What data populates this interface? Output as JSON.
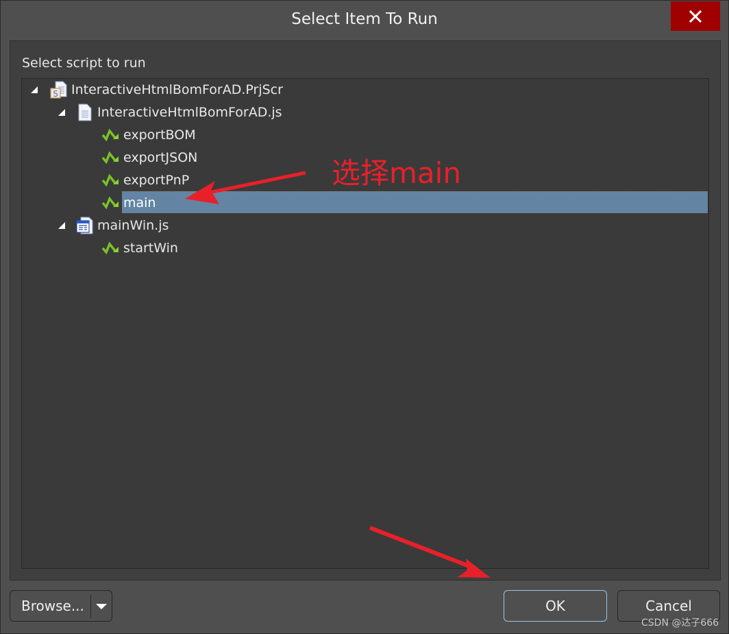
{
  "window": {
    "title": "Select Item To Run",
    "close_icon": "close-icon"
  },
  "panel": {
    "prompt": "Select script to run"
  },
  "tree": {
    "project": {
      "label": "InteractiveHtmlBomForAD.PrjScr",
      "icon": "script-project-icon",
      "expanded": true
    },
    "files": [
      {
        "label": "InteractiveHtmlBomForAD.js",
        "icon": "document-icon",
        "expanded": true,
        "items": [
          {
            "label": "exportBOM",
            "icon": "run-procedure-icon",
            "selected": false
          },
          {
            "label": "exportJSON",
            "icon": "run-procedure-icon",
            "selected": false
          },
          {
            "label": "exportPnP",
            "icon": "run-procedure-icon",
            "selected": false
          },
          {
            "label": "main",
            "icon": "run-procedure-icon",
            "selected": true
          }
        ]
      },
      {
        "label": "mainWin.js",
        "icon": "form-icon",
        "expanded": true,
        "items": [
          {
            "label": "startWin",
            "icon": "run-procedure-icon",
            "selected": false
          }
        ]
      }
    ],
    "selection_color": "#6384a3"
  },
  "buttons": {
    "browse": "Browse...",
    "ok": "OK",
    "cancel": "Cancel"
  },
  "annotation": {
    "text": "选择main",
    "color": "#e8202a"
  },
  "watermark": "CSDN @达子666"
}
